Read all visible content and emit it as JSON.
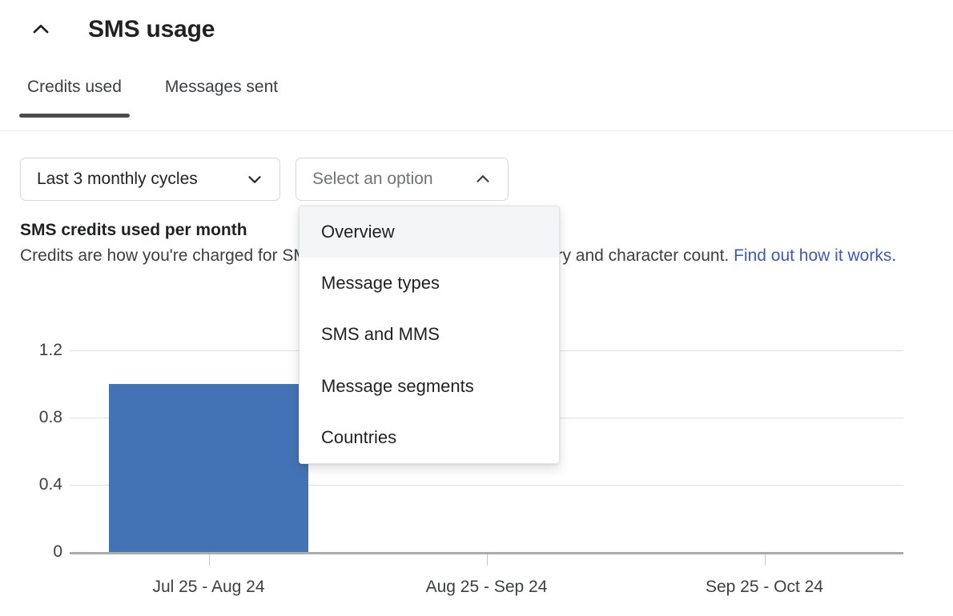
{
  "header": {
    "title": "SMS usage",
    "collapse_icon": "chevron-up-icon"
  },
  "tabs": [
    {
      "label": "Credits used",
      "active": true
    },
    {
      "label": "Messages sent",
      "active": false
    }
  ],
  "controls": {
    "cycles_select": {
      "value": "Last 3 monthly cycles",
      "icon": "chevron-down-icon"
    },
    "option_select": {
      "placeholder": "Select an option",
      "value": "Select an option",
      "icon": "chevron-up-icon",
      "expanded": true
    }
  },
  "dropdown": {
    "items": [
      {
        "label": "Overview",
        "highlighted": true
      },
      {
        "label": "Message types",
        "highlighted": false
      },
      {
        "label": "SMS and MMS",
        "highlighted": false
      },
      {
        "label": "Message segments",
        "highlighted": false
      },
      {
        "label": "Countries",
        "highlighted": false
      }
    ]
  },
  "chart_section": {
    "heading": "SMS credits used per month",
    "description_part1": "Credits are how you're charged for SMS messages, which vary by country and character count. ",
    "link_text": "Find out how it works",
    "description_part2": "."
  },
  "colors": {
    "bar": "#4473b5",
    "link": "#3a5bb8",
    "tab_underline": "#4a4d50",
    "gridline": "#dfe0e2",
    "axis": "#a9abad",
    "highlight_bg": "#f4f5f6"
  },
  "chart_data": {
    "type": "bar",
    "title": "SMS credits used per month",
    "xlabel": "",
    "ylabel": "",
    "categories": [
      "Jul 25 - Aug 24",
      "Aug 25 - Sep 24",
      "Sep 25 - Oct 24"
    ],
    "values": [
      1,
      0,
      0
    ],
    "ylim": [
      0,
      1.2
    ],
    "yticks": [
      "1.2",
      "0.8",
      "0.4",
      "0"
    ],
    "ytick_values": [
      1.2,
      0.8,
      0.4,
      0
    ],
    "grid": true,
    "legend": "none",
    "series": [
      {
        "name": "SMS credits used",
        "values": [
          1,
          0,
          0
        ],
        "color": "#4473b5"
      }
    ]
  }
}
